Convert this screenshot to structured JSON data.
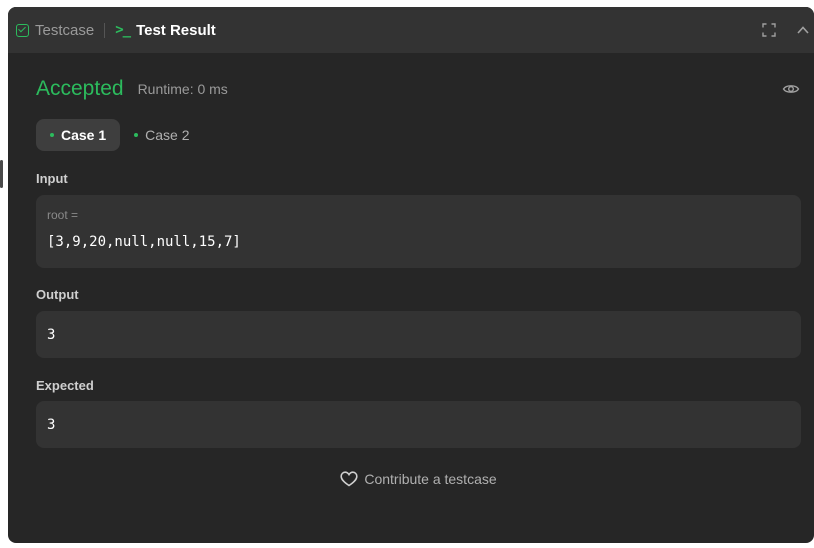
{
  "tabs": {
    "testcase_label": "Testcase",
    "result_label": "Test Result"
  },
  "result": {
    "status": "Accepted",
    "runtime": "Runtime: 0 ms"
  },
  "cases": [
    {
      "label": "Case 1",
      "active": true
    },
    {
      "label": "Case 2",
      "active": false
    }
  ],
  "input": {
    "label": "Input",
    "var_name": "root =",
    "value": "[3,9,20,null,null,15,7]"
  },
  "output": {
    "label": "Output",
    "value": "3"
  },
  "expected": {
    "label": "Expected",
    "value": "3"
  },
  "contribute_label": "Contribute a testcase",
  "colors": {
    "accent_green": "#2cbb5d",
    "panel_bg": "#262626",
    "box_bg": "#333333"
  },
  "icons": [
    "check-square-icon",
    "terminal-icon",
    "fullscreen-icon",
    "chevron-up-icon",
    "eye-icon",
    "heart-icon"
  ]
}
